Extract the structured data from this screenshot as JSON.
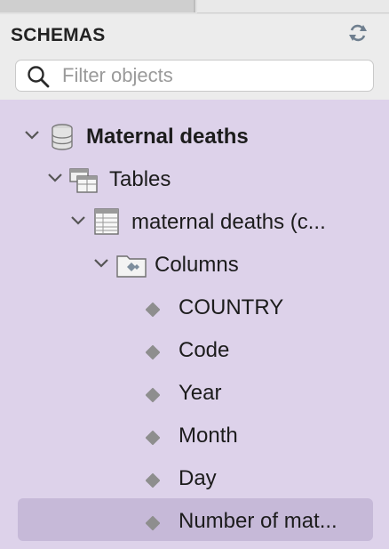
{
  "header": {
    "title": "SCHEMAS",
    "refresh_icon": "refresh-icon"
  },
  "search": {
    "placeholder": "Filter objects",
    "value": "",
    "icon": "search-icon"
  },
  "tree": {
    "schema": {
      "label": "Maternal deaths",
      "icon": "database-icon",
      "expanded": true
    },
    "tables_folder": {
      "label": "Tables",
      "icon": "tables-folder-icon",
      "expanded": true
    },
    "table": {
      "label": "maternal deaths (c...",
      "icon": "table-icon",
      "expanded": true
    },
    "columns_folder": {
      "label": "Columns",
      "icon": "columns-folder-icon",
      "expanded": true
    },
    "columns": [
      {
        "label": "COUNTRY"
      },
      {
        "label": "Code"
      },
      {
        "label": "Year"
      },
      {
        "label": "Month"
      },
      {
        "label": "Day"
      },
      {
        "label": "Number of mat...",
        "selected": true
      }
    ]
  },
  "colors": {
    "tree_background": "#ddd2ea",
    "selection": "#c6b9d8",
    "header_background": "#ececec"
  }
}
